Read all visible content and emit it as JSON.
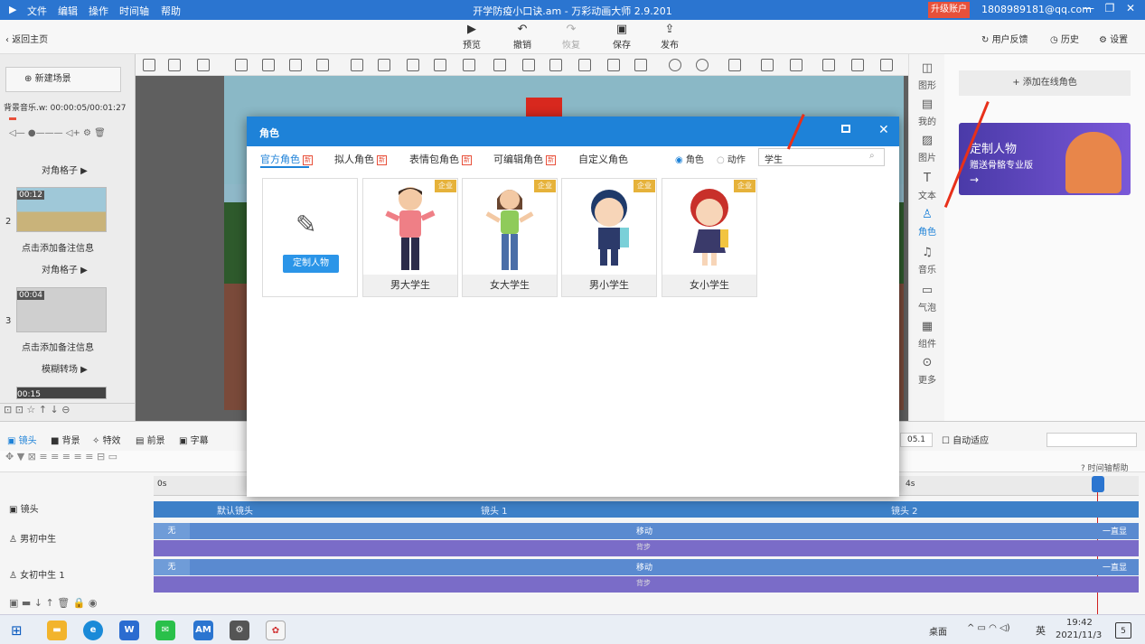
{
  "titlebar": {
    "menu": [
      "文件",
      "编辑",
      "操作",
      "时间轴",
      "帮助"
    ],
    "title": "开学防疫小口诀.am - 万彩动画大师 2.9.201",
    "upgrade": "升级账户",
    "email": "1808989181@qq.com"
  },
  "toolbar": {
    "back": "返回主页",
    "preview": "预览",
    "undo": "撤销",
    "redo": "恢复",
    "save": "保存",
    "publish": "发布",
    "feedback": "用户反馈",
    "history": "历史",
    "settings": "设置"
  },
  "left": {
    "new_scene": "新建场景",
    "bgm_label": "背景音乐.w:",
    "bgm_time": "00:00:05/00:01:27",
    "scenes": [
      {
        "num": "",
        "transition": "对角格子"
      },
      {
        "num": "2",
        "time": "00:12",
        "note": "点击添加备注信息",
        "transition": "对角格子"
      },
      {
        "num": "3",
        "time": "00:04",
        "note": "点击添加备注信息",
        "transition": "模糊转场"
      },
      {
        "num": "",
        "time": "00:15"
      }
    ]
  },
  "right_strip": [
    "图形",
    "我的",
    "图片",
    "文本",
    "角色",
    "音乐",
    "气泡",
    "组件",
    "更多"
  ],
  "right_panel": {
    "add_online": "+ 添加在线角色",
    "banner_line1": "定制人物",
    "banner_line2": "赠送骨骼专业版"
  },
  "dialog": {
    "title": "角色",
    "tabs": [
      {
        "label": "官方角色",
        "new": true
      },
      {
        "label": "拟人角色",
        "new": true
      },
      {
        "label": "表情包角色",
        "new": true
      },
      {
        "label": "可编辑角色",
        "new": true
      },
      {
        "label": "自定义角色",
        "new": false
      }
    ],
    "new_badge": "新",
    "radio_role": "角色",
    "radio_action": "动作",
    "search_value": "学生",
    "custom_button": "定制人物",
    "enterprise_tag": "企业",
    "cards": [
      "男大学生",
      "女大学生",
      "男小学生",
      "女小学生"
    ]
  },
  "timeline": {
    "tabs": [
      "镜头",
      "背景",
      "特效",
      "前景",
      "字幕"
    ],
    "zoom_value": "05.1",
    "auto_fit": "自动适应",
    "help": "时间轴帮助",
    "ruler_start": "0s",
    "ruler_mark": "4s",
    "rows": [
      {
        "name": "镜头",
        "segments": [
          "默认镜头",
          "镜头 1",
          "镜头 2"
        ]
      },
      {
        "name": "男初中生",
        "enter": "无",
        "action": "移动",
        "exit": "一直显",
        "sub": "背步"
      },
      {
        "name": "女初中生 1",
        "enter": "无",
        "action": "移动",
        "exit": "一直显",
        "sub": "背步"
      }
    ]
  },
  "taskbar": {
    "desktop": "桌面",
    "lang": "英",
    "time": "19:42",
    "date": "2021/11/3",
    "notif": "5"
  }
}
